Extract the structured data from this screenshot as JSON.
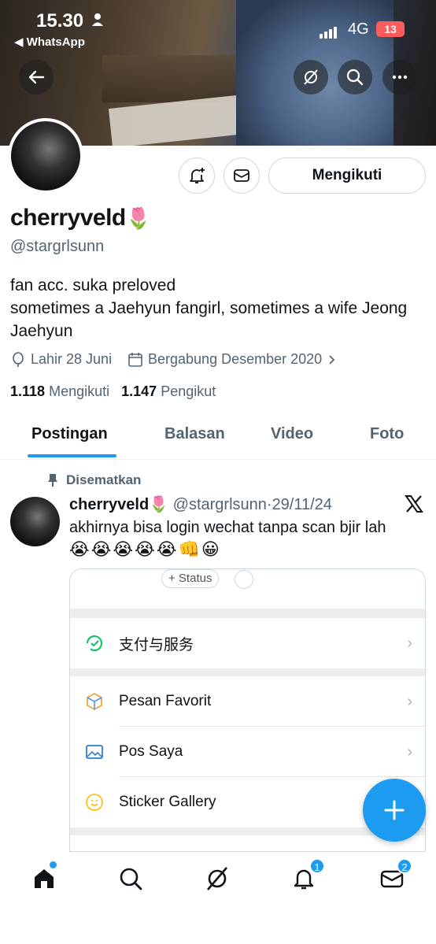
{
  "status_bar": {
    "time": "15.30",
    "back_app": "◀ WhatsApp",
    "network": "4G",
    "battery": "13"
  },
  "profile": {
    "display_name": "cherryveld",
    "name_emoji": "🌷",
    "handle": "@stargrlsunn",
    "bio_line1": "fan acc. suka preloved",
    "bio_line2": "sometimes a Jaehyun fangirl, sometimes a wife Jeong Jaehyun",
    "birthday": "Lahir 28 Juni",
    "joined": "Bergabung Desember 2020",
    "following_count": "1.118",
    "following_label": "Mengikuti",
    "followers_count": "1.147",
    "followers_label": "Pengikut",
    "follow_button": "Mengikuti"
  },
  "tabs": [
    {
      "label": "Postingan",
      "active": true
    },
    {
      "label": "Balasan",
      "active": false
    },
    {
      "label": "Video",
      "active": false
    },
    {
      "label": "Foto",
      "active": false
    }
  ],
  "pinned_tweet": {
    "pinned_label": "Disematkan",
    "author_name": "cherryveld",
    "author_emoji": "🌷",
    "author_handle": "@stargrlsunn",
    "date": "29/11/24",
    "text": "akhirnya bisa login wechat tanpa scan bjir lah",
    "emojis": "😭😭😭😭😭👊😀",
    "media": {
      "status_pill": "+ Status",
      "rows": [
        {
          "label": "支付与服务"
        },
        {
          "label": "Pesan Favorit"
        },
        {
          "label": "Pos Saya"
        },
        {
          "label": "Sticker Gallery"
        }
      ]
    }
  },
  "bottom_nav": {
    "notifications_badge": "1",
    "messages_badge": "2"
  },
  "colors": {
    "accent": "#1d9bf0",
    "secondary_text": "#536471",
    "border": "#cfd9de"
  }
}
